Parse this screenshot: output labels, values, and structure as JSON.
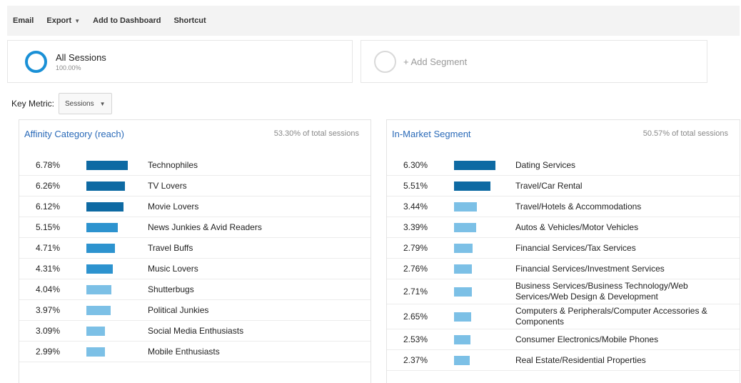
{
  "toolbar": {
    "email": "Email",
    "export": "Export",
    "add_to_dashboard": "Add to Dashboard",
    "shortcut": "Shortcut"
  },
  "segments": {
    "all": {
      "name": "All Sessions",
      "percent": "100.00%"
    },
    "add_label": "+ Add Segment"
  },
  "key_metric": {
    "label": "Key Metric:",
    "value": "Sessions"
  },
  "colors": {
    "dark": "#0e6aa3",
    "medium": "#2d93cf",
    "light": "#7cc0e6",
    "title": "#2a6ab8"
  },
  "affinity": {
    "title": "Affinity Category (reach)",
    "subtitle": "53.30% of total sessions",
    "rows": [
      {
        "pct": "6.78%",
        "value": 6.78,
        "name": "Technophiles"
      },
      {
        "pct": "6.26%",
        "value": 6.26,
        "name": "TV Lovers"
      },
      {
        "pct": "6.12%",
        "value": 6.12,
        "name": "Movie Lovers"
      },
      {
        "pct": "5.15%",
        "value": 5.15,
        "name": "News Junkies & Avid Readers"
      },
      {
        "pct": "4.71%",
        "value": 4.71,
        "name": "Travel Buffs"
      },
      {
        "pct": "4.31%",
        "value": 4.31,
        "name": "Music Lovers"
      },
      {
        "pct": "4.04%",
        "value": 4.04,
        "name": "Shutterbugs"
      },
      {
        "pct": "3.97%",
        "value": 3.97,
        "name": "Political Junkies"
      },
      {
        "pct": "3.09%",
        "value": 3.09,
        "name": "Social Media Enthusiasts"
      },
      {
        "pct": "2.99%",
        "value": 2.99,
        "name": "Mobile Enthusiasts"
      }
    ]
  },
  "in_market": {
    "title": "In-Market Segment",
    "subtitle": "50.57% of total sessions",
    "rows": [
      {
        "pct": "6.30%",
        "value": 6.3,
        "name": "Dating Services"
      },
      {
        "pct": "5.51%",
        "value": 5.51,
        "name": "Travel/Car Rental"
      },
      {
        "pct": "3.44%",
        "value": 3.44,
        "name": "Travel/Hotels & Accommodations"
      },
      {
        "pct": "3.39%",
        "value": 3.39,
        "name": "Autos & Vehicles/Motor Vehicles"
      },
      {
        "pct": "2.79%",
        "value": 2.79,
        "name": "Financial Services/Tax Services"
      },
      {
        "pct": "2.76%",
        "value": 2.76,
        "name": "Financial Services/Investment Services"
      },
      {
        "pct": "2.71%",
        "value": 2.71,
        "name": "Business Services/Business Technology/Web Services/Web Design & Development"
      },
      {
        "pct": "2.65%",
        "value": 2.65,
        "name": "Computers & Peripherals/Computer Accessories & Components"
      },
      {
        "pct": "2.53%",
        "value": 2.53,
        "name": "Consumer Electronics/Mobile Phones"
      },
      {
        "pct": "2.37%",
        "value": 2.37,
        "name": "Real Estate/Residential Properties"
      }
    ]
  }
}
